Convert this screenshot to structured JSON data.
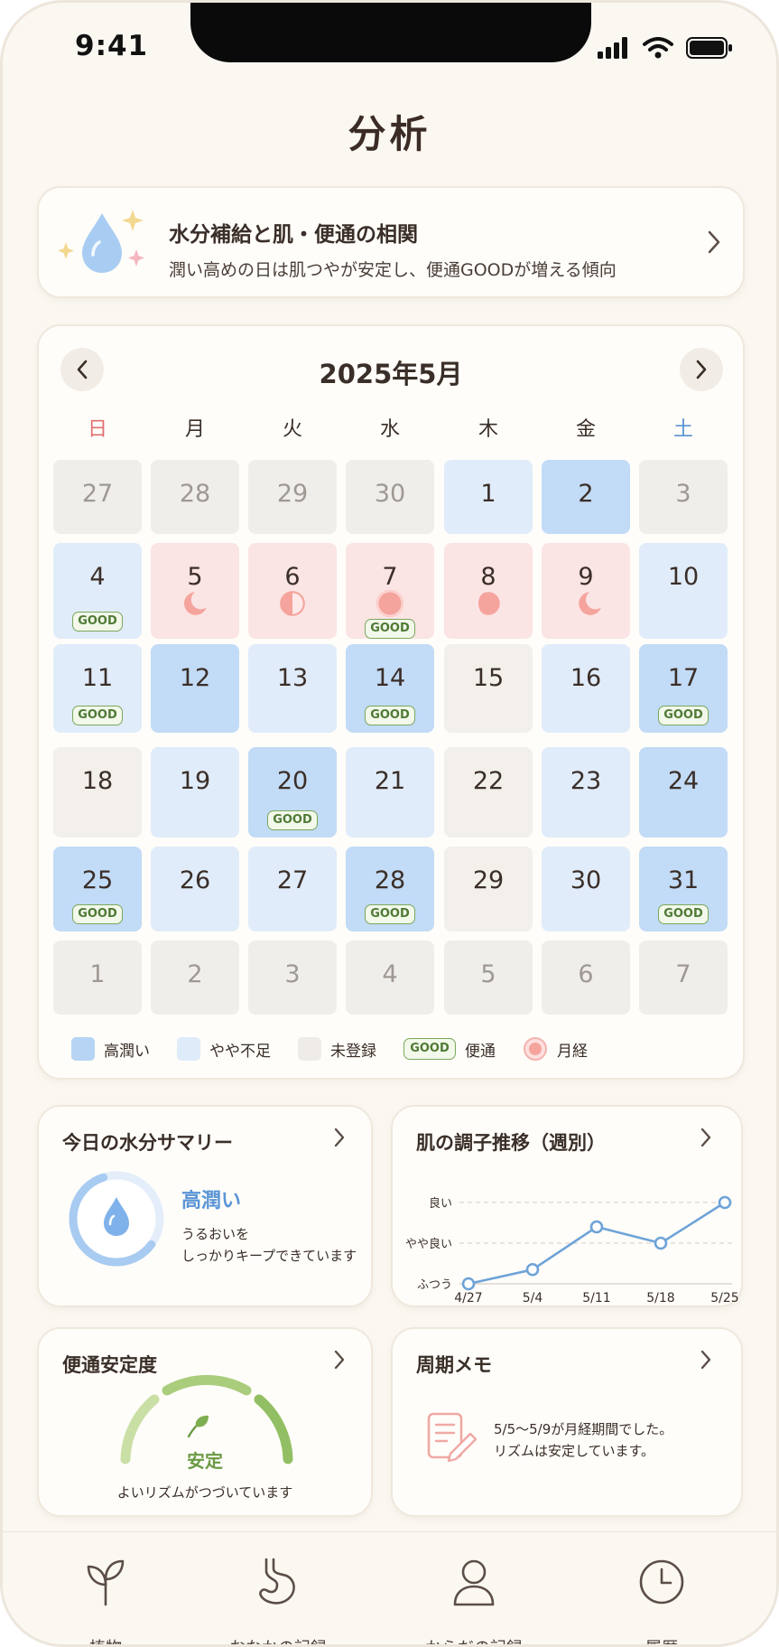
{
  "status_bar": {
    "time": "9:41"
  },
  "header": {
    "title": "分析"
  },
  "insight": {
    "title": "水分補給と肌・便通の相関",
    "subtitle": "潤い高めの日は肌つやが安定し、便通GOODが増える傾向",
    "icon": "water-drop-sparkle-icon"
  },
  "calendar": {
    "month_label": "2025年5月",
    "weekdays": [
      "日",
      "月",
      "火",
      "水",
      "木",
      "金",
      "土"
    ],
    "weekday_colors": {
      "sunday": "#e07070",
      "saturday": "#5a93d4"
    },
    "days": [
      {
        "label": "27",
        "state": "outside"
      },
      {
        "label": "28",
        "state": "outside"
      },
      {
        "label": "29",
        "state": "outside"
      },
      {
        "label": "30",
        "state": "outside"
      },
      {
        "label": "1",
        "state": "light"
      },
      {
        "label": "2",
        "state": "deep"
      },
      {
        "label": "3",
        "state": "outside"
      },
      {
        "label": "4",
        "state": "light",
        "good": "GOOD"
      },
      {
        "label": "5",
        "state": "period",
        "moon": "crescent"
      },
      {
        "label": "6",
        "state": "period",
        "moon": "half"
      },
      {
        "label": "7",
        "state": "period",
        "moon": "full",
        "good": "GOOD"
      },
      {
        "label": "8",
        "state": "period",
        "moon": "gibbous"
      },
      {
        "label": "9",
        "state": "period",
        "moon": "crescent-wane"
      },
      {
        "label": "10",
        "state": "light"
      },
      {
        "label": "11",
        "state": "light",
        "good": "GOOD"
      },
      {
        "label": "12",
        "state": "deep"
      },
      {
        "label": "13",
        "state": "light"
      },
      {
        "label": "14",
        "state": "deep",
        "good": "GOOD"
      },
      {
        "label": "15",
        "state": "unregistered"
      },
      {
        "label": "16",
        "state": "light"
      },
      {
        "label": "17",
        "state": "deep",
        "good": "GOOD"
      },
      {
        "label": "18",
        "state": "unregistered"
      },
      {
        "label": "19",
        "state": "light"
      },
      {
        "label": "20",
        "state": "deep",
        "good": "GOOD"
      },
      {
        "label": "21",
        "state": "light"
      },
      {
        "label": "22",
        "state": "unregistered"
      },
      {
        "label": "23",
        "state": "light"
      },
      {
        "label": "24",
        "state": "deep"
      },
      {
        "label": "25",
        "state": "deep",
        "good": "GOOD"
      },
      {
        "label": "26",
        "state": "light"
      },
      {
        "label": "27",
        "state": "light"
      },
      {
        "label": "28",
        "state": "deep",
        "good": "GOOD"
      },
      {
        "label": "29",
        "state": "unregistered"
      },
      {
        "label": "30",
        "state": "light"
      },
      {
        "label": "31",
        "state": "deep",
        "good": "GOOD"
      },
      {
        "label": "1",
        "state": "outside"
      },
      {
        "label": "2",
        "state": "outside"
      },
      {
        "label": "3",
        "state": "outside"
      },
      {
        "label": "4",
        "state": "outside"
      },
      {
        "label": "5",
        "state": "outside"
      },
      {
        "label": "6",
        "state": "outside"
      },
      {
        "label": "7",
        "state": "outside"
      }
    ],
    "legend": {
      "high": "高潤い",
      "low": "やや不足",
      "unregistered": "未登録",
      "good_badge": "GOOD",
      "good_label": "便通",
      "period": "月経"
    },
    "colors": {
      "deep": "#c2dbf6",
      "light": "#e0ecf9",
      "period": "#fbe4e4",
      "outside": "#f0eeea",
      "good_border": "#7aa85c"
    }
  },
  "water_summary": {
    "title": "今日の水分サマリー",
    "status": "高潤い",
    "message_line1": "うるおいを",
    "message_line2": "しっかりキープできています",
    "ring_fill": 0.6
  },
  "skin_trend": {
    "title": "肌の調子推移（週別）"
  },
  "bowel": {
    "title": "便通安定度",
    "status": "安定",
    "message": "よいリズムがつづいています"
  },
  "cycle_memo": {
    "title": "周期メモ",
    "line1": "5/5〜5/9が月経期間でした。",
    "line2": "リズムは安定しています。"
  },
  "chart_data": {
    "type": "line",
    "title": "肌の調子推移（週別）",
    "categories": [
      "4/27",
      "5/4",
      "5/11",
      "5/18",
      "5/25"
    ],
    "y_tick_labels": [
      "ふつう",
      "やや良い",
      "良い"
    ],
    "series": [
      {
        "values": [
          1.0,
          1.35,
          2.4,
          2.0,
          3.0
        ]
      }
    ],
    "ylim": [
      1,
      3
    ],
    "grid": true
  },
  "tabs": [
    {
      "label": "植物",
      "icon": "plant-icon"
    },
    {
      "label": "おなかの記録",
      "icon": "stomach-icon"
    },
    {
      "label": "からだの記録",
      "icon": "person-icon"
    },
    {
      "label": "履歴",
      "icon": "clock-icon"
    }
  ]
}
